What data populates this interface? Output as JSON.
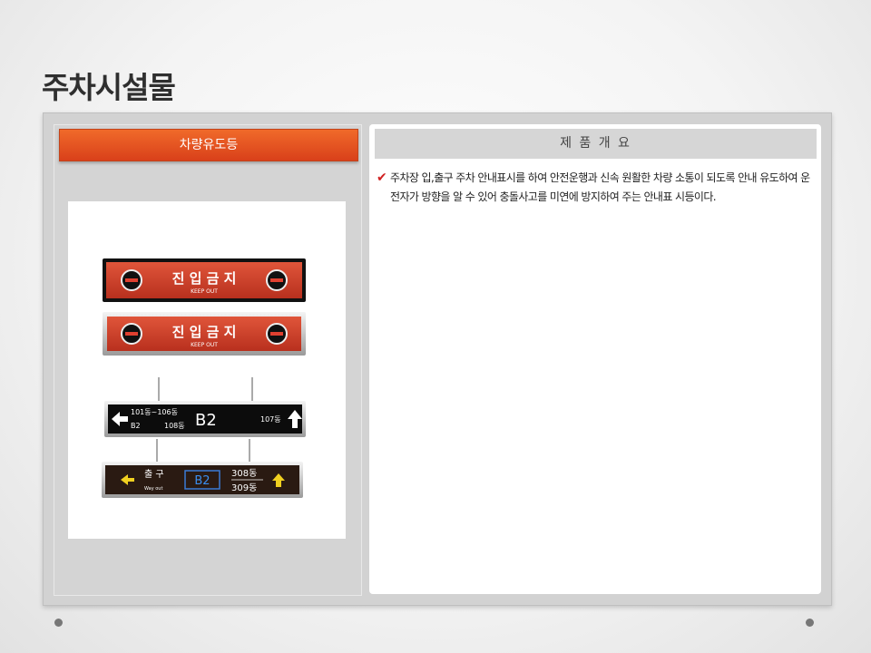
{
  "slide": {
    "title": "주차시설물"
  },
  "left": {
    "header": "차량유도등",
    "signs": {
      "sign1": {
        "main": "진 입 금 지",
        "sub": "KEEP OUT"
      },
      "sign2": {
        "main": "진 입 금 지",
        "sub": "KEEP OUT"
      },
      "sign3": {
        "left_top": "101동~106동",
        "left_bottom_a": "B2",
        "left_bottom_b": "108동",
        "center": "B2",
        "right": "107동"
      },
      "sign4": {
        "exit": "출 구",
        "exit_sub": "Way out",
        "center": "B2",
        "right_top": "308동",
        "right_bottom": "309동"
      }
    }
  },
  "right": {
    "header": "제 품 개 요",
    "description": "주차장 입,출구 주차 안내표시를 하여 안전운행과 신속 원활한 차량 소통이 되도록 안내 유도하여 운전자가 방향을 알 수 있어 충돌사고를 미연에 방지하여 주는 안내표 시등이다."
  },
  "colors": {
    "accent": "#e8552a",
    "check": "#d02020"
  }
}
